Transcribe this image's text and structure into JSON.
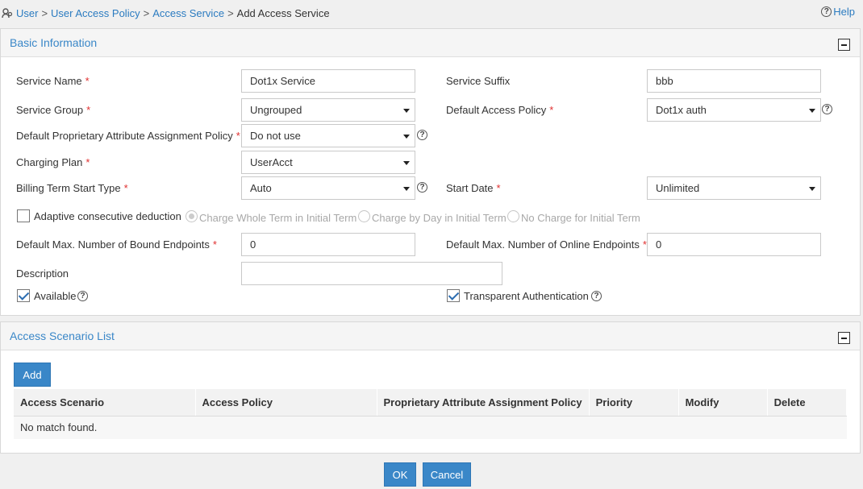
{
  "breadcrumb": {
    "items": [
      "User",
      "User Access Policy",
      "Access Service"
    ],
    "separator": ">",
    "current": "Add Access Service"
  },
  "help_label": "Help",
  "basic_info": {
    "title": "Basic Information",
    "service_name": {
      "label": "Service Name",
      "value": "Dot1x Service"
    },
    "service_suffix": {
      "label": "Service Suffix",
      "value": "bbb"
    },
    "service_group": {
      "label": "Service Group",
      "value": "Ungrouped"
    },
    "default_access_policy": {
      "label": "Default Access Policy",
      "value": "Dot1x auth"
    },
    "default_proprietary_policy": {
      "label": "Default Proprietary Attribute Assignment Policy",
      "value": "Do not use"
    },
    "charging_plan": {
      "label": "Charging Plan",
      "value": "UserAcct"
    },
    "billing_term_start_type": {
      "label": "Billing Term Start Type",
      "value": "Auto"
    },
    "start_date": {
      "label": "Start Date",
      "value": "Unlimited"
    },
    "adaptive_deduction": {
      "label": "Adaptive consecutive deduction",
      "checked": false,
      "options": [
        "Charge Whole Term in Initial Term",
        "Charge by Day in Initial Term",
        "No Charge for Initial Term"
      ],
      "selected": "Charge Whole Term in Initial Term"
    },
    "max_bound_endpoints": {
      "label": "Default Max. Number of Bound Endpoints",
      "value": "0"
    },
    "max_online_endpoints": {
      "label": "Default Max. Number of Online Endpoints",
      "value": "0"
    },
    "description": {
      "label": "Description",
      "value": ""
    },
    "available": {
      "label": "Available",
      "checked": true
    },
    "transparent_auth": {
      "label": "Transparent Authentication",
      "checked": true
    },
    "required_mark": "*",
    "help_glyph": "?"
  },
  "scenario_list": {
    "title": "Access Scenario List",
    "add_label": "Add",
    "columns": [
      "Access Scenario",
      "Access Policy",
      "Proprietary Attribute Assignment Policy",
      "Priority",
      "Modify",
      "Delete"
    ],
    "empty_message": "No match found."
  },
  "footer": {
    "ok_label": "OK",
    "cancel_label": "Cancel"
  },
  "colors": {
    "accent": "#3a87c8",
    "required": "#e03030"
  }
}
